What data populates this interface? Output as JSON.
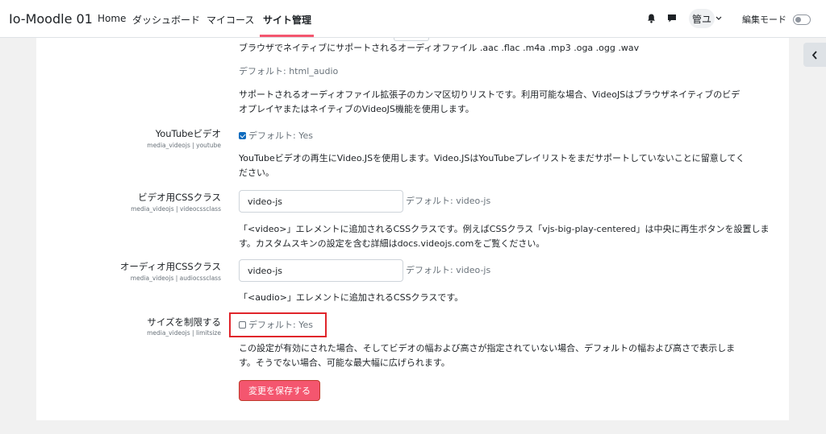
{
  "navbar": {
    "brand": "Io-Moodle 01",
    "items": [
      {
        "label": "Home"
      },
      {
        "label": "ダッシュボード"
      },
      {
        "label": "マイコース"
      },
      {
        "label": "サイト管理"
      }
    ],
    "user_initials": "管ユ",
    "edit_mode_label": "編集モード"
  },
  "settings": {
    "audio_extensions": {
      "value_text": "ブラウザでネイティブにサポートされるオーディオファイル .aac .flac .m4a .mp3 .oga .ogg .wav",
      "default_text": "デフォルト: html_audio",
      "description_line1": "サポートされるオーディオファイル拡張子のカンマ区切りリストです。利用可能な場合、VideoJSはブラウザネイティブのビデ",
      "description_line2": "オプレイヤまたはネイティブのVideoJS機能を使用します。"
    },
    "youtube": {
      "label": "YouTubeビデオ",
      "shortname": "media_videojs | youtube",
      "checked": true,
      "default_text": "デフォルト: Yes",
      "description_line1": "YouTubeビデオの再生にVideo.JSを使用します。Video.JSはYouTubeプレイリストをまだサポートしていないことに留意してく",
      "description_line2": "ださい。"
    },
    "videocssclass": {
      "label": "ビデオ用CSSクラス",
      "shortname": "media_videojs | videocssclass",
      "value": "video-js",
      "default_text": "デフォルト: video-js",
      "description_line1": "「<video>」エレメントに追加されるCSSクラスです。例えばCSSクラス「vjs-big-play-centered」は中央に再生ボタンを設置しま",
      "description_line2": "す。カスタムスキンの設定を含む詳細はdocs.videojs.comをご覧ください。"
    },
    "audiocssclass": {
      "label": "オーディオ用CSSクラス",
      "shortname": "media_videojs | audiocssclass",
      "value": "video-js",
      "default_text": "デフォルト: video-js",
      "description_line1": "「<audio>」エレメントに追加されるCSSクラスです。"
    },
    "limitsize": {
      "label": "サイズを制限する",
      "shortname": "media_videojs | limitsize",
      "checked": false,
      "default_text": "デフォルト: Yes",
      "description_line1": "この設定が有効にされた場合、そしてビデオの幅および高さが指定されていない場合、デフォルトの幅および高さで表示しま",
      "description_line2": "す。そうでない場合、可能な最大幅に広げられます。"
    }
  },
  "save_button_label": "変更を保存する",
  "colors": {
    "accent": "#f4566f",
    "checkbox": "#0f6cbf",
    "highlight_box": "#e0252b"
  }
}
